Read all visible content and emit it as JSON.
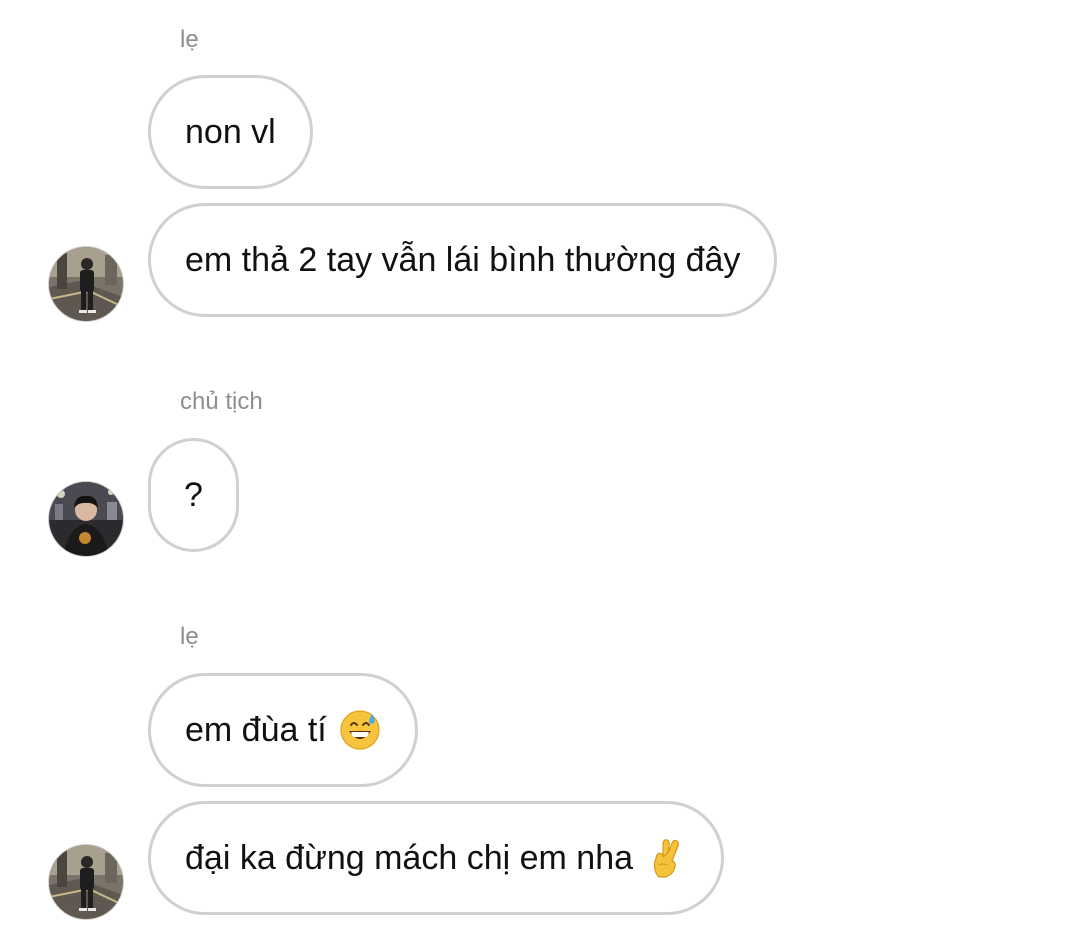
{
  "conversation": {
    "groups": [
      {
        "sender": "lẹ",
        "messages": [
          {
            "text": "non vl"
          },
          {
            "text": "em thả 2 tay vẫn lái bình thường đây"
          }
        ]
      },
      {
        "sender": "chủ tịch",
        "messages": [
          {
            "text": "?"
          }
        ]
      },
      {
        "sender": "lẹ",
        "messages": [
          {
            "text": "em đùa tí",
            "emoji": "grinning-face-with-sweat-icon"
          },
          {
            "text": "đại ka đừng mách chị em nha",
            "emoji": "crossed-fingers-icon"
          }
        ]
      }
    ]
  },
  "colors": {
    "bubble_border": "#d0d0d0",
    "sender_label": "#8e8e8e",
    "text": "#111111",
    "background": "#ffffff"
  }
}
